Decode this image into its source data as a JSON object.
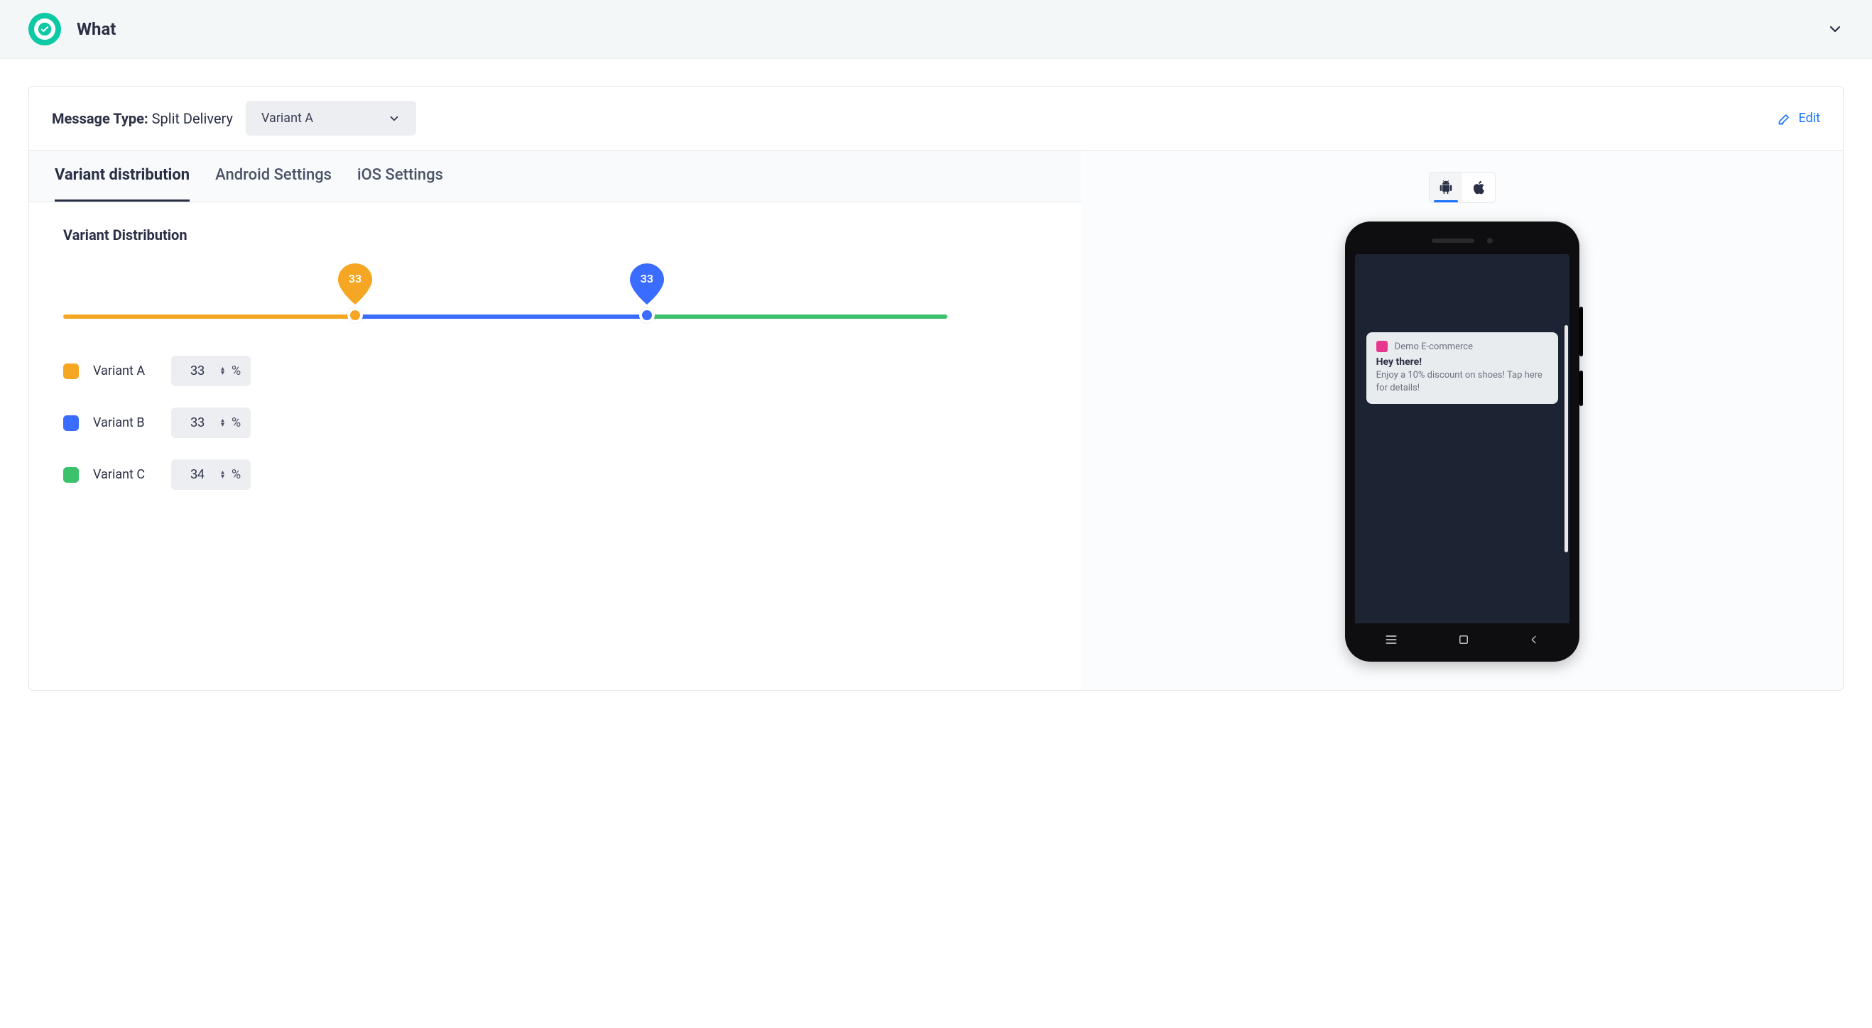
{
  "header": {
    "title": "What"
  },
  "topbar": {
    "message_type_label": "Message Type:",
    "message_type_value": "Split Delivery",
    "variant_selected": "Variant A",
    "edit_label": "Edit"
  },
  "tabs": [
    {
      "id": "variant",
      "label": "Variant distribution",
      "active": true
    },
    {
      "id": "android",
      "label": "Android Settings",
      "active": false
    },
    {
      "id": "ios",
      "label": "iOS Settings",
      "active": false
    }
  ],
  "distribution": {
    "title": "Variant Distribution",
    "unit": "%",
    "variants": [
      {
        "id": "a",
        "name": "Variant A",
        "value": 33,
        "colorKey": "sw-a"
      },
      {
        "id": "b",
        "name": "Variant B",
        "value": 33,
        "colorKey": "sw-b"
      },
      {
        "id": "c",
        "name": "Variant C",
        "value": 34,
        "colorKey": "sw-c"
      }
    ],
    "markers": [
      {
        "id": "a",
        "value": 33,
        "color": "#f5a623"
      },
      {
        "id": "b",
        "value": 33,
        "color": "#3a6cff"
      }
    ]
  },
  "preview": {
    "platforms": [
      {
        "id": "android",
        "active": true
      },
      {
        "id": "ios",
        "active": false
      }
    ],
    "notification": {
      "app_name": "Demo E-commerce",
      "title": "Hey there!",
      "body": "Enjoy a 10% discount on shoes! Tap here for details!"
    }
  },
  "colors": {
    "orange": "#f5a623",
    "blue": "#3a6cff",
    "green": "#3cc26b",
    "teal": "#0dcaa4",
    "link": "#1a73ff"
  }
}
